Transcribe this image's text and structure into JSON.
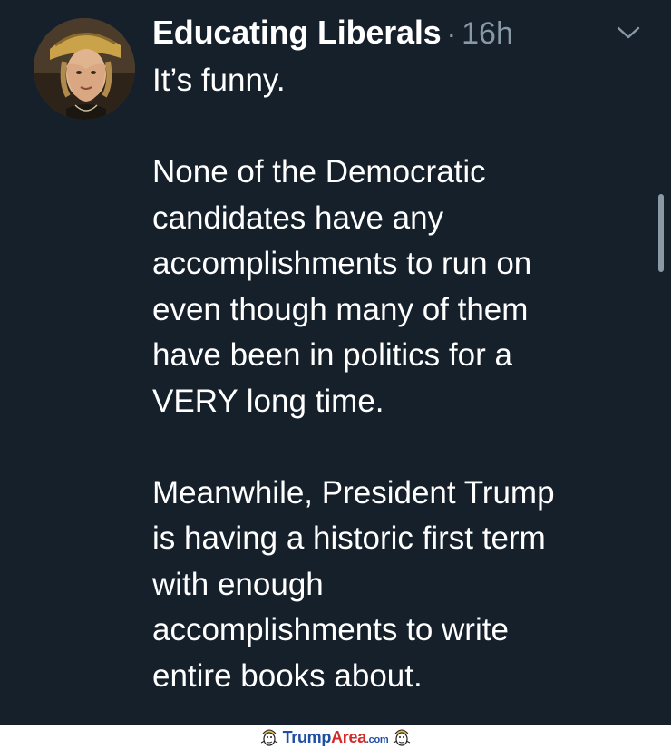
{
  "tweet": {
    "author_name": "Educating Liberals",
    "separator": "·",
    "time_ago": "16h",
    "avatar": "profile-photo",
    "menu_icon": "chevron-down-icon",
    "paragraphs": [
      {
        "lines": [
          "It’s funny."
        ]
      },
      {
        "lines": [
          "None of the Democratic",
          "candidates have any",
          "accomplishments to run on",
          "even though many of them",
          "have been in politics for a",
          "VERY long time."
        ]
      },
      {
        "lines": [
          "Meanwhile, President Trump",
          "is having a historic first term",
          "with enough",
          "accomplishments to write",
          "entire books about."
        ]
      }
    ]
  },
  "watermark": {
    "part1": "Trump",
    "part2": "Area",
    "suffix": ".com",
    "icon": "cartoon-face-icon"
  },
  "colors": {
    "background": "#15202b",
    "primary_text": "#ffffff",
    "secondary_text": "#8899a6",
    "watermark_blue": "#1f4fa3",
    "watermark_red": "#d42a2a"
  }
}
